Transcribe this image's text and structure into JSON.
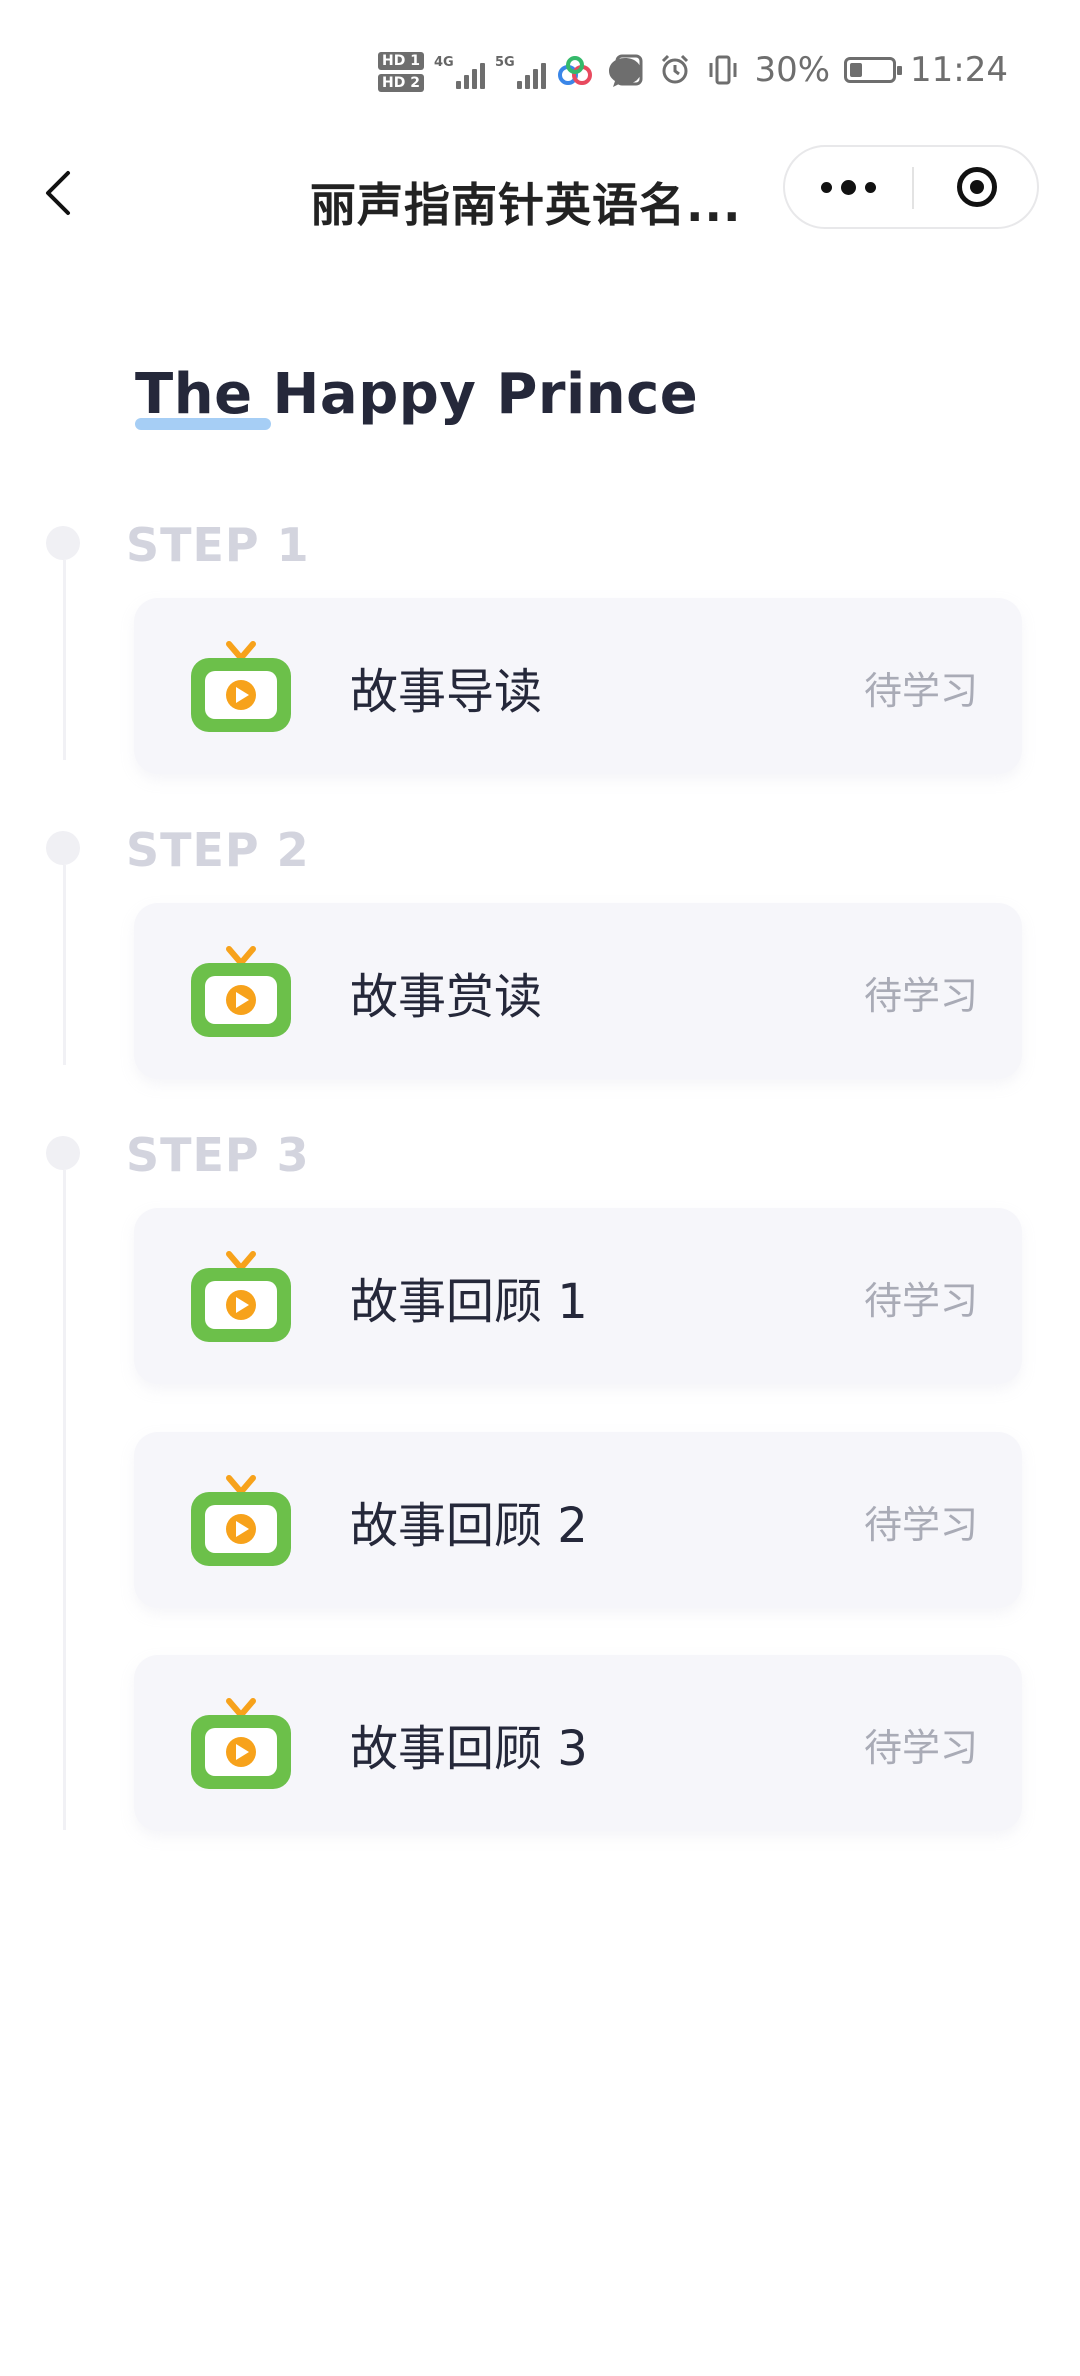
{
  "status_bar": {
    "hd1": "HD 1",
    "hd2": "HD 2",
    "network1": "4G",
    "network2": "5G",
    "battery_percent": "30%",
    "battery_level": 0.3,
    "time": "11:24"
  },
  "nav": {
    "title": "丽声指南针英语名...",
    "icons": [
      "back-chevron-icon",
      "more-dots-icon",
      "close-target-icon"
    ]
  },
  "book": {
    "title": "The Happy Prince"
  },
  "steps": [
    {
      "label": "STEP 1",
      "items": [
        {
          "title": "故事导读",
          "status": "待学习"
        }
      ]
    },
    {
      "label": "STEP 2",
      "items": [
        {
          "title": "故事赏读",
          "status": "待学习"
        }
      ]
    },
    {
      "label": "STEP 3",
      "items": [
        {
          "title": "故事回顾 1",
          "status": "待学习"
        },
        {
          "title": "故事回顾 2",
          "status": "待学习"
        },
        {
          "title": "故事回顾 3",
          "status": "待学习"
        }
      ]
    }
  ],
  "colors": {
    "tv_green": "#6cc04a",
    "tv_orange": "#f7a21b",
    "underline_blue": "#9cc9f4",
    "card_bg": "#f6f6fa"
  }
}
